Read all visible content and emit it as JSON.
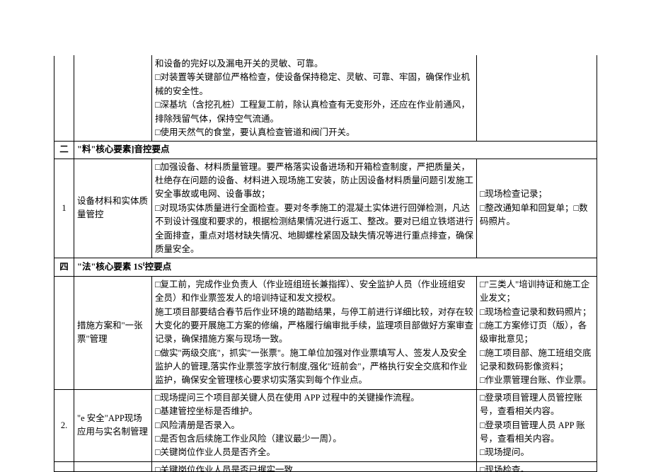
{
  "row_top": {
    "content": "和设备的完好以及漏电开关的灵敏、可靠。\n□对装置等关键部位严格检查，使设备保持稳定、灵敏、可靠、牢固，确保作业机械的安全性。\n□深基坑（含挖孔桩）工程复工前，除认真检查有无变形外，还应在作业前通风，排除残留气体，保持空气流通。\n□使用天然气的食堂，要认真检查管道和阀门开关。"
  },
  "section2": {
    "num": "二",
    "title": "\"料\"核心要素]音控要点"
  },
  "row_s2_1": {
    "num": "1",
    "item": "设备材料和实体质量管控",
    "content": "□加强设备、材料质量管理。要严格落实设备进场和开箱检查制度，严把质量关，杜绝存在问题的设备、材料进入现场施工安装，防止因设备材料质量问题引发施工安全事故或电网、设备事故；\n□对现场实体质量进行全面检查。要对冬季施工的混凝土实体进行回弹检测，凡达不到设计强度和要求的，根据检测结果情况进行返工、整改。要对已组立铁塔进行全面排查，重点对塔材缺失情况、地脚螺栓紧固及缺失情况等进行重点排查，确保质量安全。",
    "note": "□现场检查记录；\n□整改通知单和回复单；□数码照片。"
  },
  "section4": {
    "num": "四",
    "title": "\"法\"核心要素 1S'控要点"
  },
  "row_s4_1": {
    "num": "",
    "item": "措施方案和\"一张票\"管理",
    "content": "□复工前，完成作业负责人（作业班组班长兼指挥）、安全监护人员（作业班组安全员）和作业票签发人的培训持证和发文授权。\n施工项目部要结合春节后作业环境的踏勘结果，与停工前进行详细比较，对存在较大变化的要开展施工方案的修编，严格履行编审批手续，监理项目部做好方案审查记录，确保措施方案与现场一致。\n□做实\"两级交底\"，抓实\"一张票\"。施工单位加强对作业票填写人、签发人及安全监护人的管理,落实作业票签字放行制度,强化\"班前会\"，严格执行安全交底和作业监护，确保安全管理核心要求切实落实到每个作业点。",
    "note": "□\"三类人\"培训持证和施工企业发文；\n□现场检查记录和数码照片；\n□施工方案修订页（版），各级审批意见；\n□施工项目部、施工班组交底记录和数码影像资料；\n□作业票管理台账、作业票。"
  },
  "row_s4_2": {
    "num": "2.",
    "item": "\"e 安全\"APP现场应用与实名制管理",
    "content": "□现场提问三个项目部关键人员在使用 APP 过程中的关键操作流程。\n□基建管控坐标是否维护。\n□风险清册是否录入。\n□是否包含后续施工作业风险（建议最少一周）。\n□关键岗位作业人员是否齐全。",
    "note": "□登录项目管理人员管控账号，查看相关内容。\n□登录项目管理人员 APP 账号，查看相关内容。\n□现场提问。"
  },
  "row_clip": {
    "content": "□关键岗位作业人员是否已据实一致",
    "note": "□现场检查。"
  }
}
